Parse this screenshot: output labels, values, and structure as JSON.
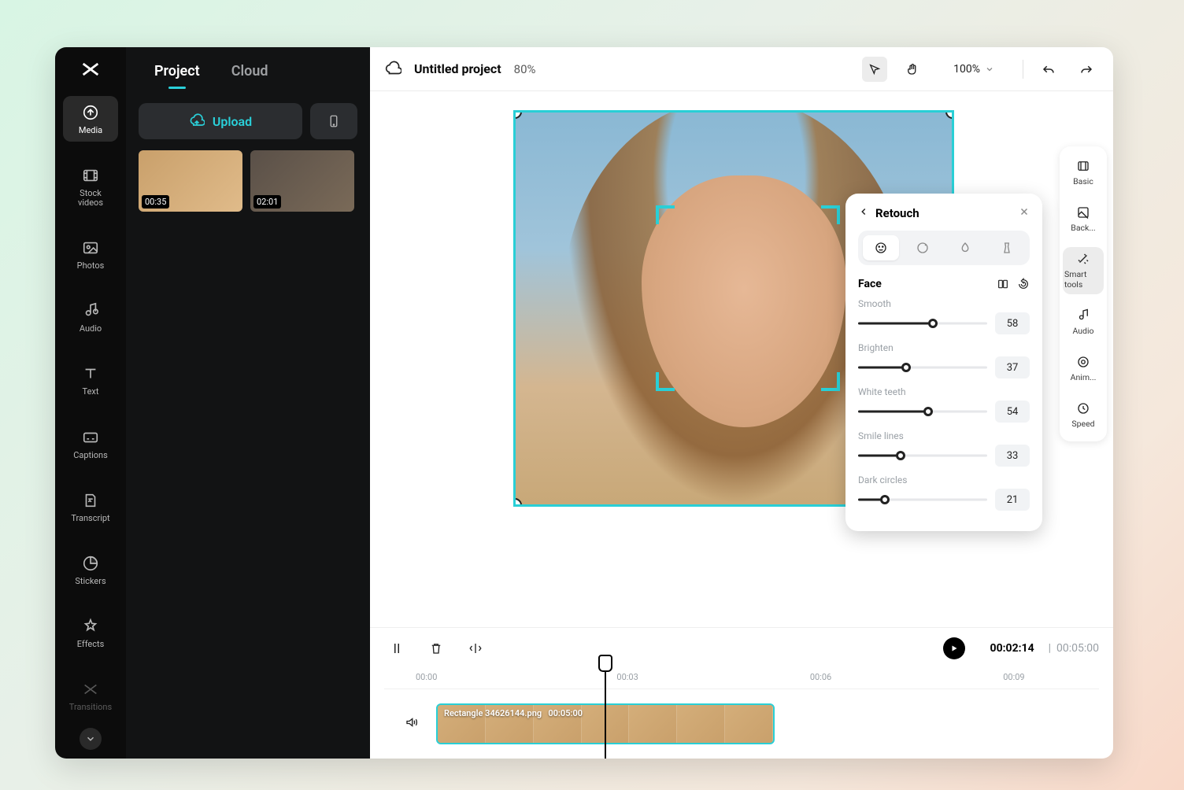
{
  "header": {
    "project_title": "Untitled project",
    "scale_pct": "80%",
    "zoom_pct": "100%"
  },
  "panel_tabs": {
    "project": "Project",
    "cloud": "Cloud"
  },
  "upload": {
    "label": "Upload"
  },
  "media_thumbs": [
    {
      "duration": "00:35"
    },
    {
      "duration": "02:01"
    }
  ],
  "sidebar_items": [
    {
      "label": "Media"
    },
    {
      "label": "Stock videos"
    },
    {
      "label": "Photos"
    },
    {
      "label": "Audio"
    },
    {
      "label": "Text"
    },
    {
      "label": "Captions"
    },
    {
      "label": "Transcript"
    },
    {
      "label": "Stickers"
    },
    {
      "label": "Effects"
    },
    {
      "label": "Transitions"
    }
  ],
  "right_rail": [
    {
      "label": "Basic"
    },
    {
      "label": "Back..."
    },
    {
      "label": "Smart tools"
    },
    {
      "label": "Audio"
    },
    {
      "label": "Anim..."
    },
    {
      "label": "Speed"
    }
  ],
  "retouch": {
    "title": "Retouch",
    "section": "Face",
    "sliders": [
      {
        "label": "Smooth",
        "value": 58
      },
      {
        "label": "Brighten",
        "value": 37
      },
      {
        "label": "White teeth",
        "value": 54
      },
      {
        "label": "Smile lines",
        "value": 33
      },
      {
        "label": "Dark circles",
        "value": 21
      }
    ]
  },
  "timeline": {
    "current": "00:02:14",
    "separator": "|",
    "duration": "00:05:00",
    "ticks": [
      "00:00",
      "00:03",
      "00:06",
      "00:09"
    ],
    "clip_label": "Rectangle 34626144.png",
    "clip_duration": "00:05:00"
  }
}
